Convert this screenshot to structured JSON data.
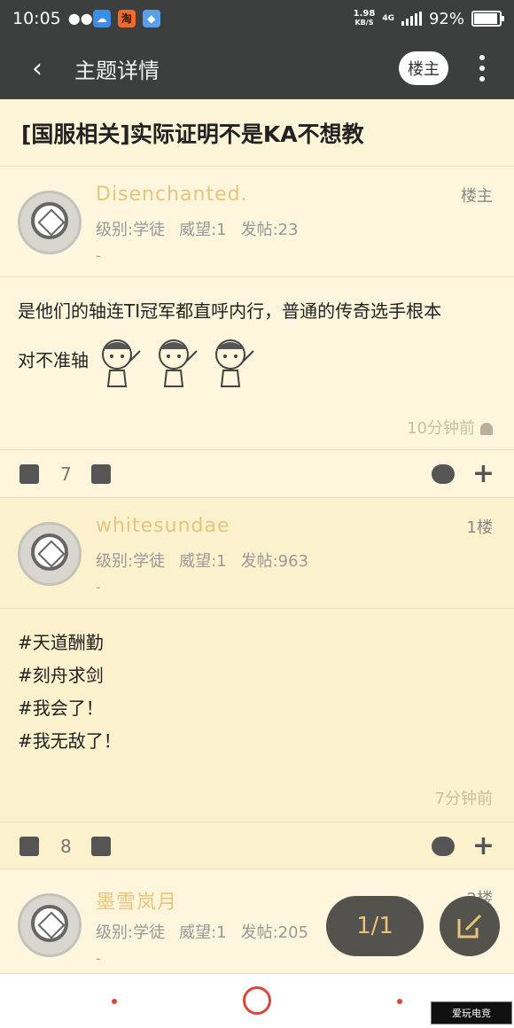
{
  "status_bar": {
    "time": "10:05",
    "speed_value": "1.98",
    "speed_unit": "KB/S",
    "network": "4G",
    "battery": "92%",
    "battery_level": 0.92,
    "app_icons": [
      "wechat-icon",
      "cloud-icon",
      "taobao-icon",
      "shield-icon"
    ]
  },
  "app_bar": {
    "title": "主题详情",
    "op_filter_label": "楼主"
  },
  "topic": {
    "title": "[国服相关]实际证明不是KA不想教"
  },
  "posts": [
    {
      "username": "Disenchanted.",
      "floor": "楼主",
      "level": "级别:学徒",
      "prestige": "威望:1",
      "post_count": "发帖:23",
      "signature": "-",
      "content_line1": "是他们的轴连TI冠军都直呼内行，普通的传奇选手根本",
      "content_line2": "对不准轴",
      "stickers": 3,
      "time": "10分钟前",
      "likes": "7"
    },
    {
      "username": "whitesundae",
      "floor": "1楼",
      "level": "级别:学徒",
      "prestige": "威望:1",
      "post_count": "发帖:963",
      "signature": "-",
      "lines": [
        "#天道酬勤",
        "#刻舟求剑",
        "#我会了！",
        "#我无敌了！"
      ],
      "time": "7分钟前",
      "likes": "8"
    },
    {
      "username": "墨雪岚月",
      "floor": "2楼",
      "level": "级别:学徒",
      "prestige": "威望:1",
      "post_count": "发帖:205",
      "signature": "-"
    }
  ],
  "fab": {
    "page_indicator": "1/1"
  },
  "watermark": "爱玩电竞",
  "colors": {
    "header_bg": "#3c3f3d",
    "username": "#e6c57d",
    "page_bg": "#fdf6dc",
    "accent_red": "#d9463b"
  }
}
